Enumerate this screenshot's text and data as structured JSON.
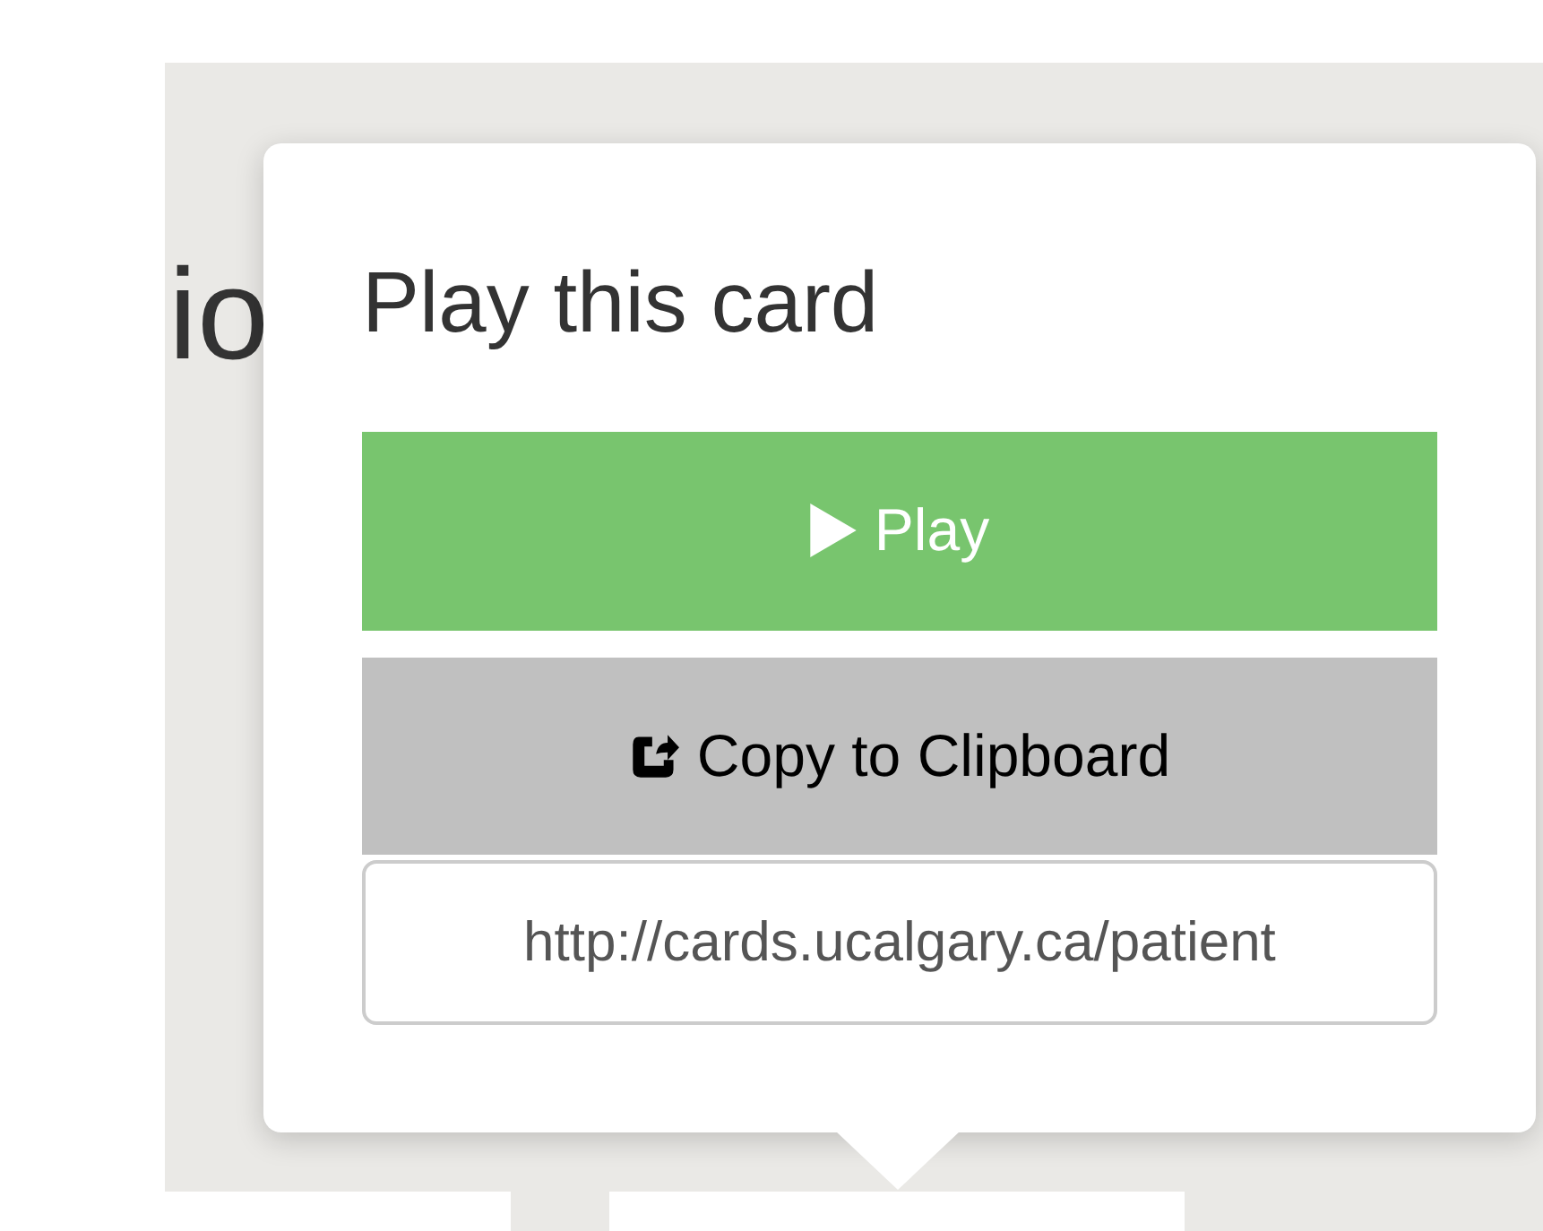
{
  "background_heading": "io",
  "popover": {
    "title": "Play this card",
    "buttons": [
      {
        "kind": "play",
        "label": "Play"
      },
      {
        "kind": "copy",
        "label": "Copy to Clipboard"
      }
    ],
    "link_field": {
      "value": "http://cards.ucalgary.ca/patient"
    }
  }
}
